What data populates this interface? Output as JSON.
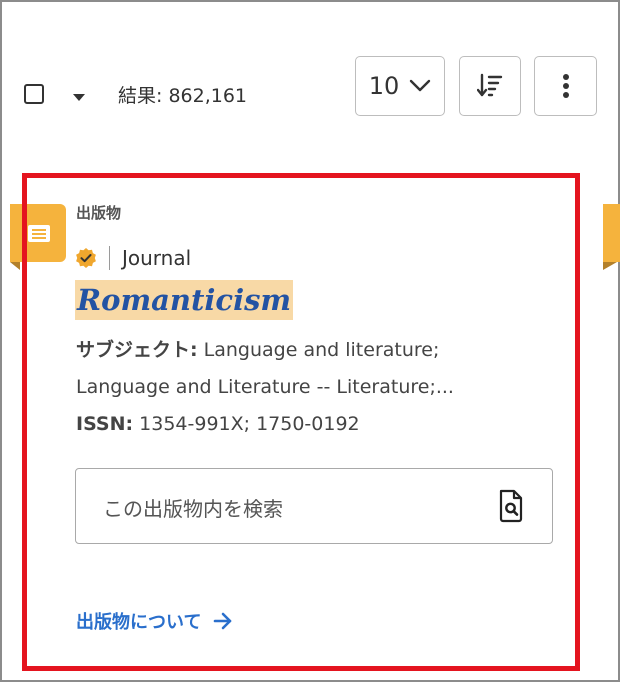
{
  "toolbar": {
    "results_label": "結果: 862,161",
    "page_size": "10",
    "icons": {
      "dropdown": "caret-down-icon",
      "chevron": "chevron-down-icon",
      "sort": "sort-icon",
      "more": "more-vertical-icon"
    }
  },
  "result": {
    "type_label": "出版物",
    "content_type": "Journal",
    "title": "Romanticism",
    "subjects_label": "サブジェクト:",
    "subjects_line1": "Language and literature;",
    "subjects_line2": "Language and Literature -- Literature;...",
    "issn_label": "ISSN:",
    "issn_value": "1354-991X; 1750-0192",
    "search_placeholder": "この出版物内を検索",
    "about_link": "出版物について"
  },
  "colors": {
    "accent": "#2a6fcc",
    "title": "#2353a3",
    "title_highlight": "#f8d9a6",
    "badge": "#f5b33d",
    "highlight_border": "#e4141f"
  }
}
